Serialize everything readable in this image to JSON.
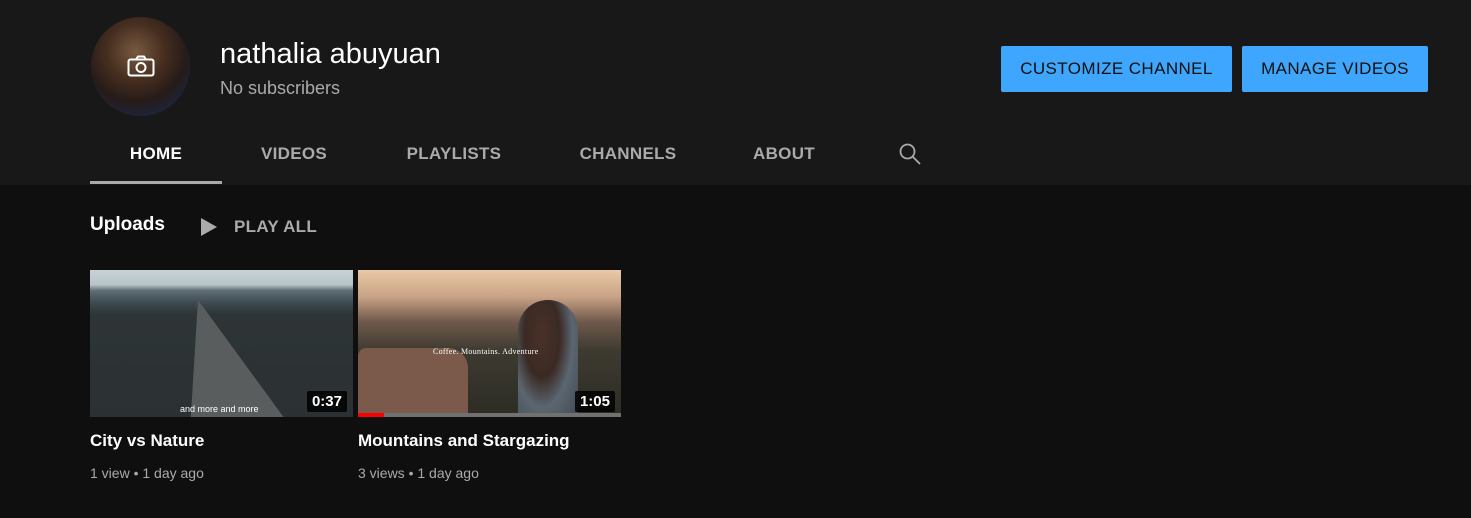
{
  "channel": {
    "name": "nathalia abuyuan",
    "subscribers": "No subscribers"
  },
  "actions": {
    "customize_label": "CUSTOMIZE CHANNEL",
    "manage_label": "MANAGE VIDEOS"
  },
  "tabs": [
    {
      "label": "HOME",
      "active": true
    },
    {
      "label": "VIDEOS",
      "active": false
    },
    {
      "label": "PLAYLISTS",
      "active": false
    },
    {
      "label": "CHANNELS",
      "active": false
    },
    {
      "label": "ABOUT",
      "active": false
    }
  ],
  "uploads": {
    "title": "Uploads",
    "play_all_label": "PLAY ALL"
  },
  "videos": [
    {
      "title": "City vs Nature",
      "duration": "0:37",
      "meta": "1 view • 1 day ago",
      "thumb_caption": "and more and more",
      "progress": 0
    },
    {
      "title": "Mountains and Stargazing",
      "duration": "1:05",
      "meta": "3 views • 1 day ago",
      "thumb_caption": "Coffee. Mountains. Adventure",
      "progress": 0.1
    }
  ],
  "colors": {
    "accent": "#3ea6ff",
    "header_bg": "#181818",
    "page_bg": "#0f0f0f",
    "progress": "#ff0000"
  },
  "icons": {
    "avatar_overlay": "camera-icon",
    "tab_search": "search-icon",
    "play_all": "play-icon"
  }
}
